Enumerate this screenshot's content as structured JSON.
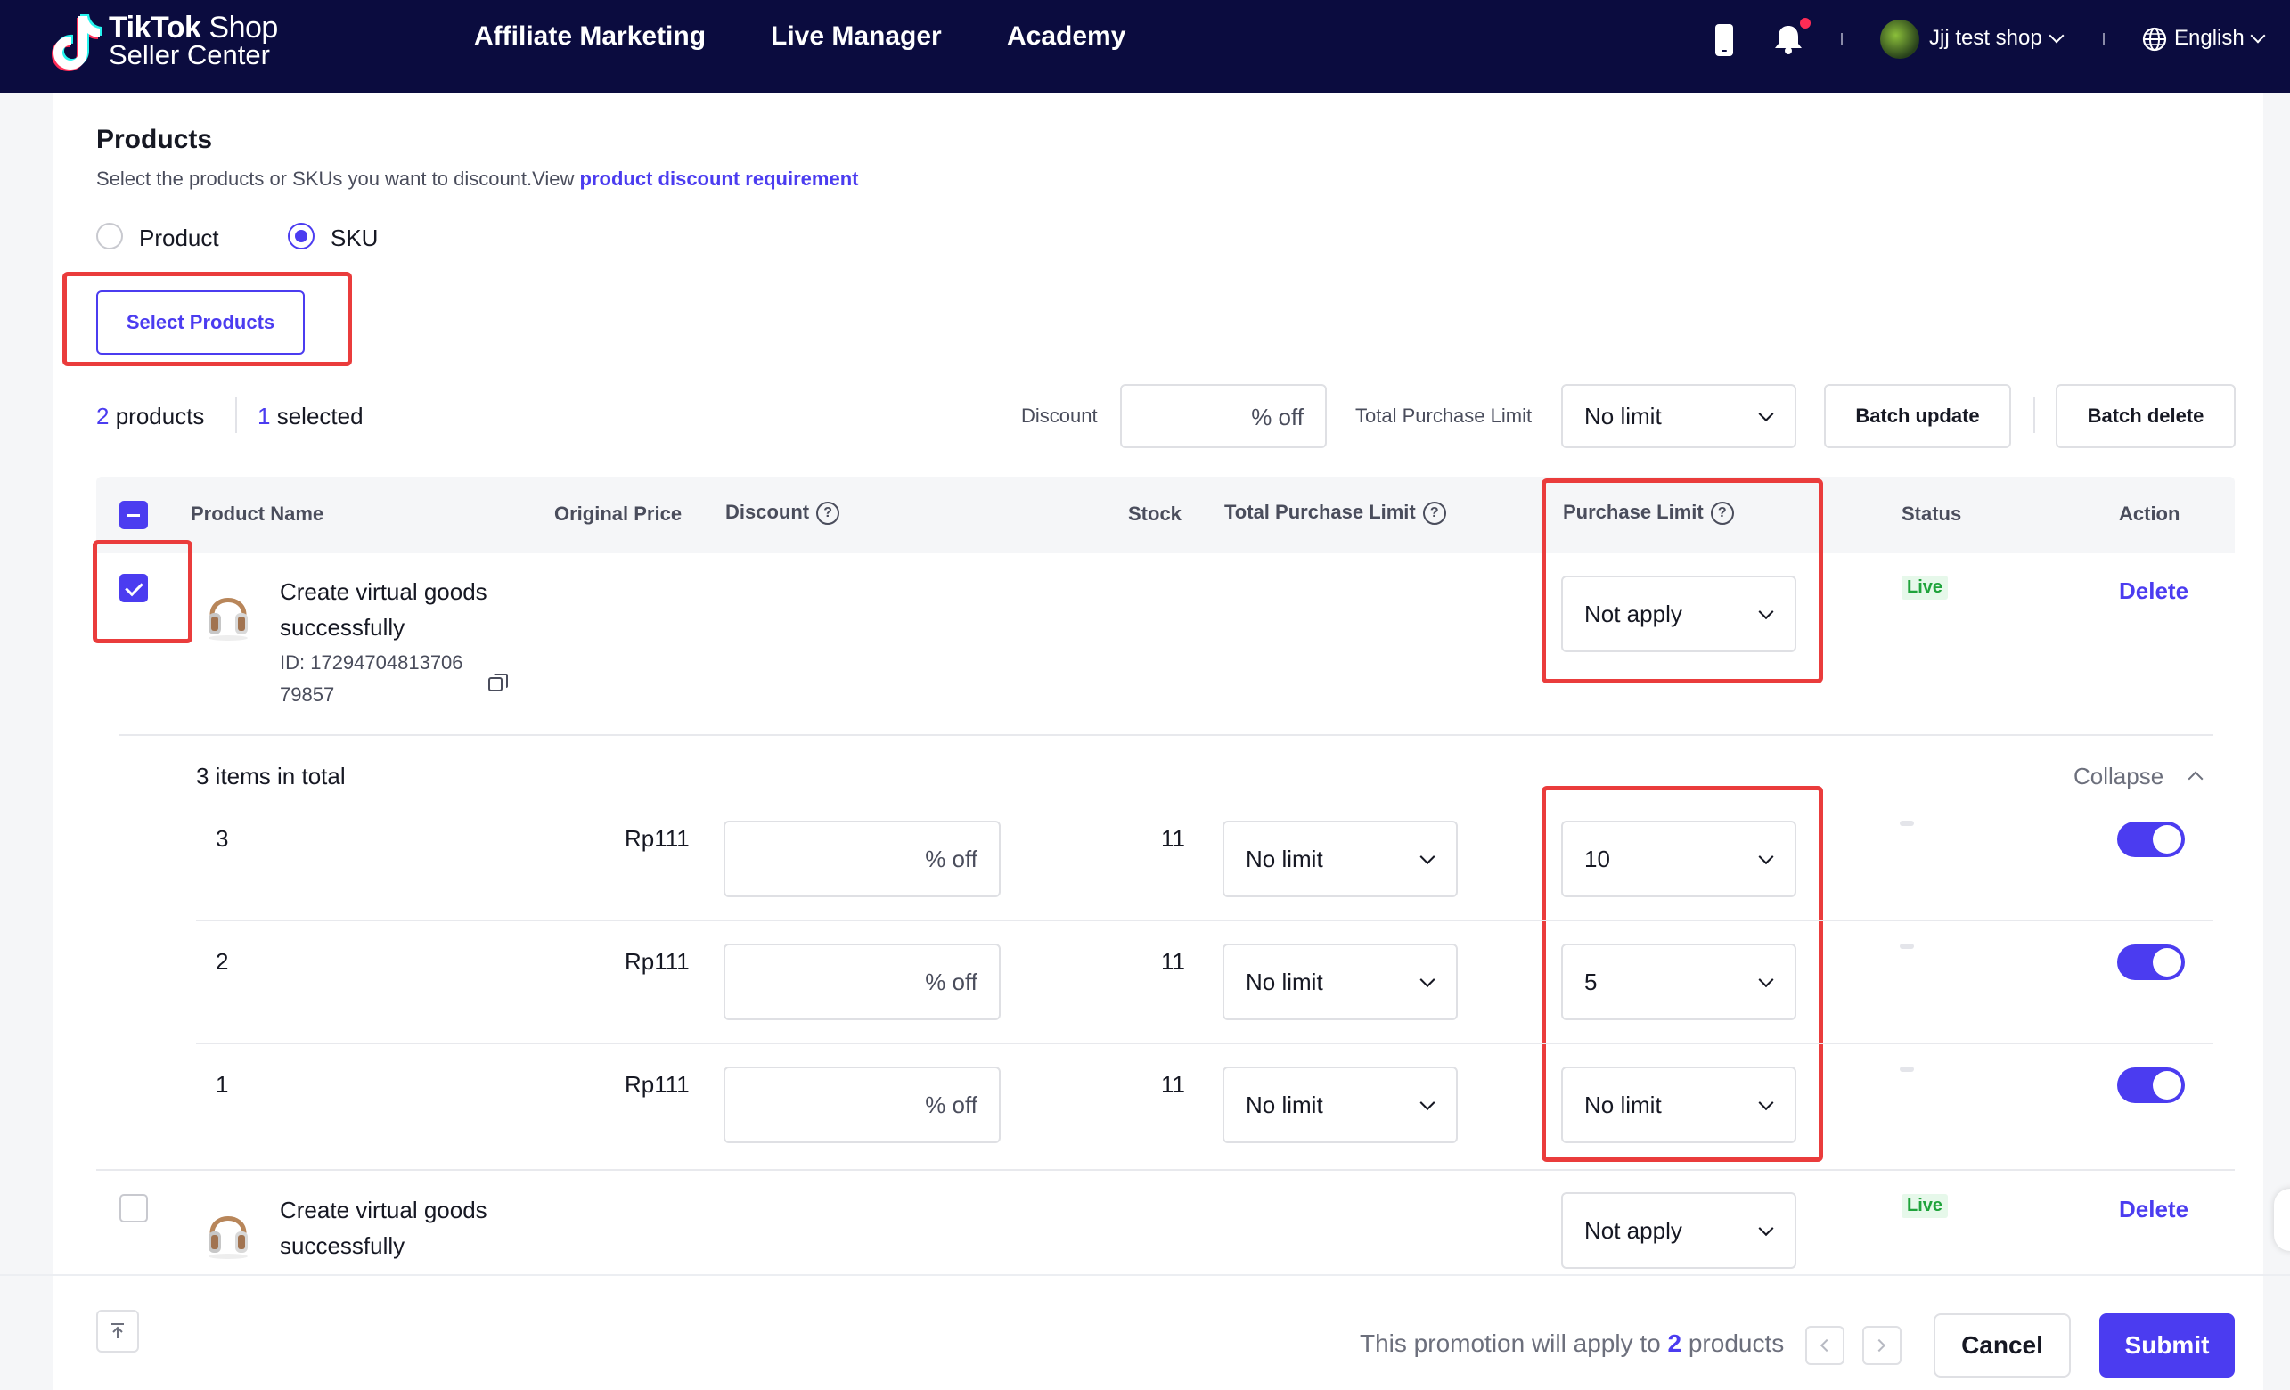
{
  "header": {
    "logo_line1_bold": "TikTok",
    "logo_line1_thin": "Shop",
    "logo_line2": "Seller Center",
    "nav": [
      "Affiliate Marketing",
      "Live Manager",
      "Academy"
    ],
    "shop_name": "Jjj test shop",
    "language": "English",
    "icons": [
      "phone-icon",
      "bell-icon",
      "globe-icon"
    ]
  },
  "products_section": {
    "title": "Products",
    "subtitle": "Select the products or SKUs you want to discount.View ",
    "subtitle_link": "product discount requirement",
    "radio_product": "Product",
    "radio_sku": "SKU",
    "selected_mode": "SKU",
    "select_button": "Select Products"
  },
  "summary": {
    "products_count": "2",
    "products_label": "products",
    "selected_count": "1",
    "selected_label": "selected"
  },
  "batch": {
    "discount_label": "Discount",
    "discount_suffix": "% off",
    "total_limit_label": "Total Purchase Limit",
    "total_limit_value": "No limit",
    "batch_update": "Batch update",
    "batch_delete": "Batch delete"
  },
  "table": {
    "headers": {
      "product_name": "Product Name",
      "original_price": "Original Price",
      "discount": "Discount",
      "stock": "Stock",
      "total_purchase_limit": "Total Purchase Limit",
      "purchase_limit": "Purchase Limit",
      "status": "Status",
      "action": "Action"
    },
    "products": [
      {
        "name_line1": "Create virtual goods",
        "name_line2": "successfully",
        "id_line1": "ID: 17294704813706",
        "id_line2": "79857",
        "purchase_limit": "Not apply",
        "status": "Live",
        "action": "Delete",
        "checked": true
      },
      {
        "name_line1": "Create virtual goods",
        "name_line2": "successfully",
        "purchase_limit": "Not apply",
        "status": "Live",
        "action": "Delete",
        "checked": false
      }
    ],
    "sku_group": {
      "total_label": "3 items in total",
      "collapse_label": "Collapse",
      "rows": [
        {
          "sku": "3",
          "price": "Rp111",
          "discount_suffix": "% off",
          "stock": "11",
          "total_limit": "No limit",
          "purchase_limit": "10"
        },
        {
          "sku": "2",
          "price": "Rp111",
          "discount_suffix": "% off",
          "stock": "11",
          "total_limit": "No limit",
          "purchase_limit": "5"
        },
        {
          "sku": "1",
          "price": "Rp111",
          "discount_suffix": "% off",
          "stock": "11",
          "total_limit": "No limit",
          "purchase_limit": "No limit"
        }
      ]
    }
  },
  "footer": {
    "apply_text_prefix": "This promotion will apply to",
    "apply_count": "2",
    "apply_text_suffix": "products",
    "cancel": "Cancel",
    "submit": "Submit"
  },
  "colors": {
    "nav_bg": "#0b0c3f",
    "primary": "#4b3cf0",
    "highlight": "#ea3c3c",
    "live_green": "#1fa33b"
  }
}
